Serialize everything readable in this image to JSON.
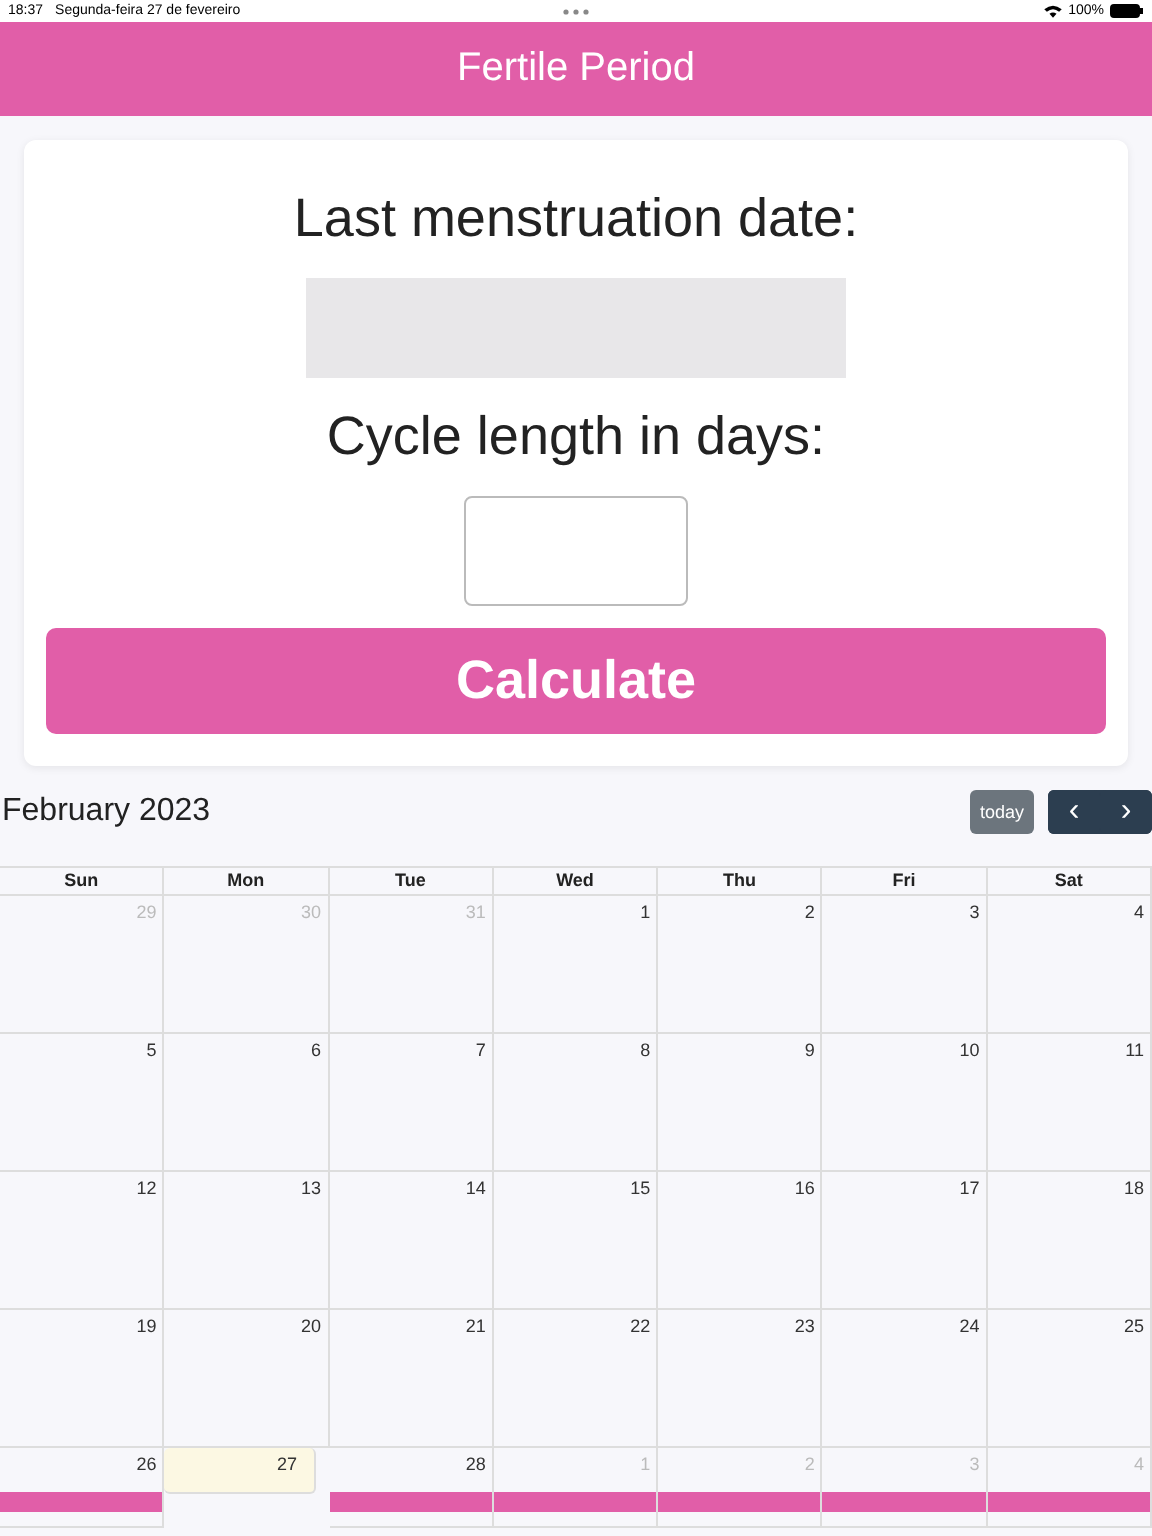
{
  "status_bar": {
    "time": "18:37",
    "date": "Segunda-feira 27 de fevereiro",
    "battery": "100%"
  },
  "header": {
    "title": "Fertile Period"
  },
  "form": {
    "date_label": "Last menstruation date:",
    "cycle_label": "Cycle length in days:",
    "button": "Calculate"
  },
  "calendar": {
    "title": "February 2023",
    "today_button": "today",
    "prev": "‹",
    "next": "›",
    "weekdays": [
      "Sun",
      "Mon",
      "Tue",
      "Wed",
      "Thu",
      "Fri",
      "Sat"
    ],
    "weeks": [
      [
        {
          "day": "29",
          "other_month": true,
          "today": false,
          "fertile": false
        },
        {
          "day": "30",
          "other_month": true,
          "today": false,
          "fertile": false
        },
        {
          "day": "31",
          "other_month": true,
          "today": false,
          "fertile": false
        },
        {
          "day": "1",
          "other_month": false,
          "today": false,
          "fertile": false
        },
        {
          "day": "2",
          "other_month": false,
          "today": false,
          "fertile": false
        },
        {
          "day": "3",
          "other_month": false,
          "today": false,
          "fertile": false
        },
        {
          "day": "4",
          "other_month": false,
          "today": false,
          "fertile": false
        }
      ],
      [
        {
          "day": "5",
          "other_month": false,
          "today": false,
          "fertile": false
        },
        {
          "day": "6",
          "other_month": false,
          "today": false,
          "fertile": false
        },
        {
          "day": "7",
          "other_month": false,
          "today": false,
          "fertile": false
        },
        {
          "day": "8",
          "other_month": false,
          "today": false,
          "fertile": false
        },
        {
          "day": "9",
          "other_month": false,
          "today": false,
          "fertile": false
        },
        {
          "day": "10",
          "other_month": false,
          "today": false,
          "fertile": false
        },
        {
          "day": "11",
          "other_month": false,
          "today": false,
          "fertile": false
        }
      ],
      [
        {
          "day": "12",
          "other_month": false,
          "today": false,
          "fertile": false
        },
        {
          "day": "13",
          "other_month": false,
          "today": false,
          "fertile": false
        },
        {
          "day": "14",
          "other_month": false,
          "today": false,
          "fertile": false
        },
        {
          "day": "15",
          "other_month": false,
          "today": false,
          "fertile": false
        },
        {
          "day": "16",
          "other_month": false,
          "today": false,
          "fertile": false
        },
        {
          "day": "17",
          "other_month": false,
          "today": false,
          "fertile": false
        },
        {
          "day": "18",
          "other_month": false,
          "today": false,
          "fertile": false
        }
      ],
      [
        {
          "day": "19",
          "other_month": false,
          "today": false,
          "fertile": false
        },
        {
          "day": "20",
          "other_month": false,
          "today": false,
          "fertile": false
        },
        {
          "day": "21",
          "other_month": false,
          "today": false,
          "fertile": false
        },
        {
          "day": "22",
          "other_month": false,
          "today": false,
          "fertile": false
        },
        {
          "day": "23",
          "other_month": false,
          "today": false,
          "fertile": false
        },
        {
          "day": "24",
          "other_month": false,
          "today": false,
          "fertile": false
        },
        {
          "day": "25",
          "other_month": false,
          "today": false,
          "fertile": false
        }
      ],
      [
        {
          "day": "26",
          "other_month": false,
          "today": false,
          "fertile": true
        },
        {
          "day": "27",
          "other_month": false,
          "today": true,
          "fertile": false
        },
        {
          "day": "28",
          "other_month": false,
          "today": false,
          "fertile": true
        },
        {
          "day": "1",
          "other_month": true,
          "today": false,
          "fertile": true
        },
        {
          "day": "2",
          "other_month": true,
          "today": false,
          "fertile": true
        },
        {
          "day": "3",
          "other_month": true,
          "today": false,
          "fertile": true
        },
        {
          "day": "4",
          "other_month": true,
          "today": false,
          "fertile": true
        }
      ]
    ]
  }
}
